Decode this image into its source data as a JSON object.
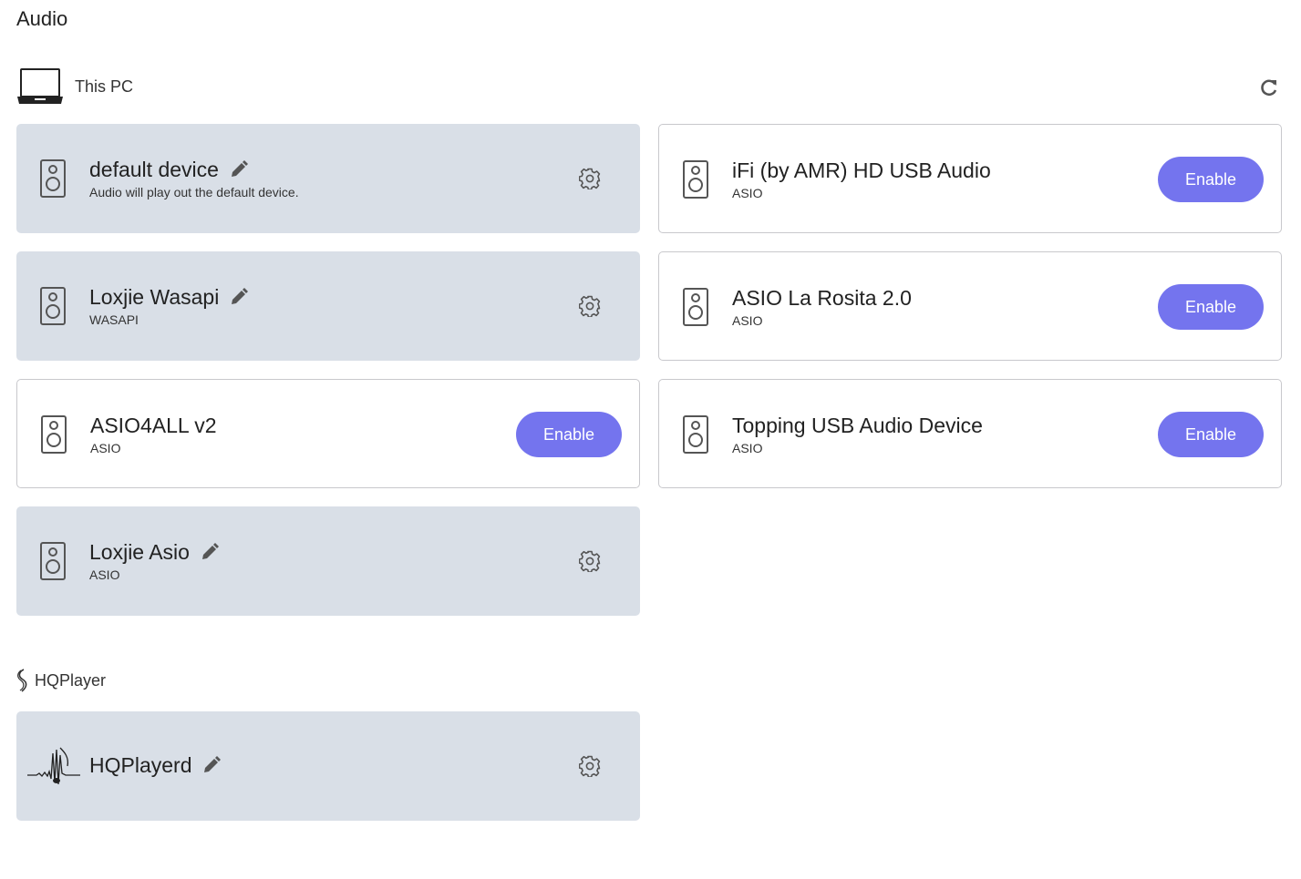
{
  "page": {
    "title": "Audio"
  },
  "sections": {
    "this_pc": {
      "label": "This PC"
    },
    "hqplayer": {
      "label": "HQPlayer"
    }
  },
  "devices": {
    "default_device": {
      "name": "default device",
      "sub": "Audio will play out the default device."
    },
    "loxjie_wasapi": {
      "name": "Loxjie Wasapi",
      "sub": "WASAPI"
    },
    "asio4all": {
      "name": "ASIO4ALL v2",
      "sub": "ASIO",
      "button": "Enable"
    },
    "loxjie_asio": {
      "name": "Loxjie Asio",
      "sub": "ASIO"
    },
    "ifi": {
      "name": "iFi (by AMR) HD USB Audio",
      "sub": "ASIO",
      "button": "Enable"
    },
    "la_rosita": {
      "name": "ASIO La Rosita 2.0",
      "sub": "ASIO",
      "button": "Enable"
    },
    "topping": {
      "name": "Topping USB Audio Device",
      "sub": "ASIO",
      "button": "Enable"
    },
    "hqplayerd": {
      "name": "HQPlayerd"
    }
  },
  "colors": {
    "active_card": "#d9dfe7",
    "enable_button": "#7474ee",
    "icon": "#555555"
  },
  "icons": [
    "laptop-icon",
    "refresh-icon",
    "speaker-icon",
    "pencil-icon",
    "gear-icon",
    "hqplayer-logo-icon",
    "hqplayer-waveform-icon"
  ]
}
